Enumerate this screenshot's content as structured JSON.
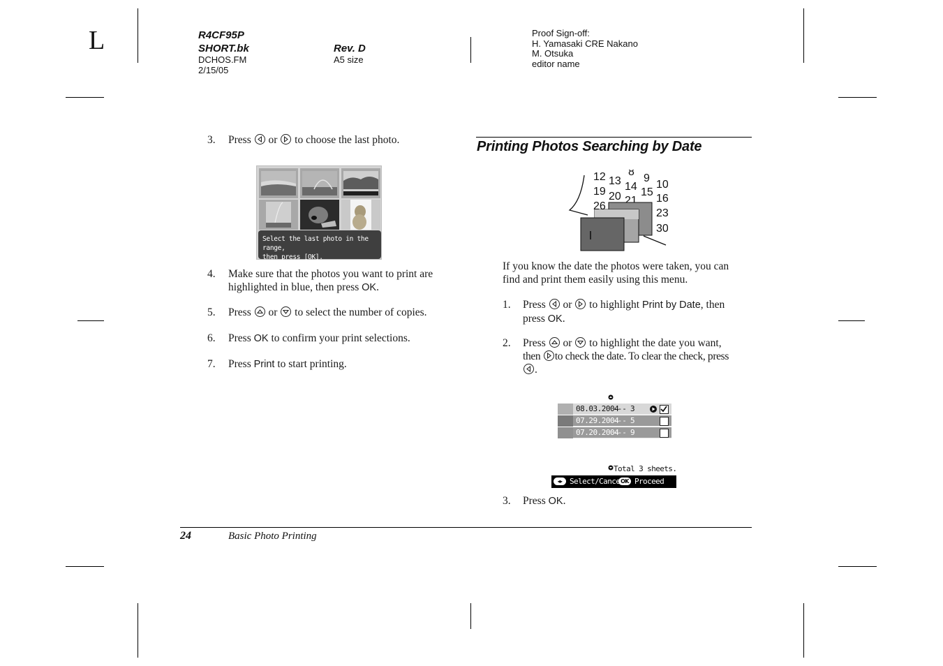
{
  "side_letter": "L",
  "header": {
    "doc_code": "R4CF95P",
    "book": "SHORT.bk",
    "file": "DCHOS.FM",
    "date": "2/15/05",
    "revision": "Rev. D",
    "size": "A5 size",
    "proof_lines": [
      "Proof Sign-off:",
      "H. Yamasaki CRE Nakano",
      "M. Otsuka",
      "editor name"
    ]
  },
  "left_column": {
    "steps": [
      {
        "num": "3.",
        "pre": "Press",
        "icon1": "left-button-icon",
        "mid": "or",
        "icon2": "right-button-icon",
        "post": "to choose the last photo."
      },
      {
        "num": "4.",
        "line1": "Make sure that the photos you want to print are",
        "line2_pre": "highlighted in blue, then press ",
        "line2_key": "OK",
        "line2_post": "."
      },
      {
        "num": "5.",
        "pre": "Press",
        "icon1": "up-button-icon",
        "mid": "or",
        "icon2": "down-button-icon",
        "post": "to select the number of copies."
      },
      {
        "num": "6.",
        "pre": "Press ",
        "key": "OK",
        "post": " to confirm your print selections."
      },
      {
        "num": "7.",
        "pre": "Press ",
        "key": "Print",
        "post": " to start printing."
      }
    ],
    "lcd_screen": {
      "message_line1": "Select the last photo in the range,",
      "message_line2": "then press [OK]."
    }
  },
  "right_column": {
    "section_title": "Printing Photos Searching by Date",
    "calendar_numbers": [
      "12",
      "13",
      "8",
      "9",
      "10",
      "19",
      "20",
      "14",
      "15",
      "16",
      "26",
      "21",
      "23",
      "30"
    ],
    "intro_line1": "If you know the date the photos were taken, you can",
    "intro_line2": "find and print them easily using this menu.",
    "steps": [
      {
        "num": "1.",
        "pre": "Press",
        "mid": "or",
        "post": "to highlight ",
        "key": "Print by Date",
        "tail": ", then",
        "line2_pre": "press ",
        "line2_key": "OK",
        "line2_post": "."
      },
      {
        "num": "2.",
        "pre": "Press",
        "mid": "or",
        "post": "to highlight the date you want,",
        "line2_pre": "then",
        "line2_post": "to check the date. To clear the check, press",
        "line3_post": "."
      },
      {
        "num": "3.",
        "pre": "Press ",
        "key": "OK",
        "post": "."
      }
    ],
    "date_list": [
      {
        "date": "08.03.2004",
        "dash": "---",
        "count": "3",
        "checked": true,
        "selected": true
      },
      {
        "date": "07.29.2004",
        "dash": "---",
        "count": "5",
        "checked": false,
        "selected": false
      },
      {
        "date": "07.20.2004",
        "dash": "---",
        "count": "9",
        "checked": false,
        "selected": false
      }
    ],
    "total_text": "Total 3 sheets.",
    "status_bar": {
      "select_icon": "◂▸",
      "select_label": "Select/Cancel",
      "ok_icon": "OK",
      "proceed_label": "Proceed"
    }
  },
  "footer": {
    "page_number": "24",
    "chapter": "Basic Photo Printing"
  }
}
